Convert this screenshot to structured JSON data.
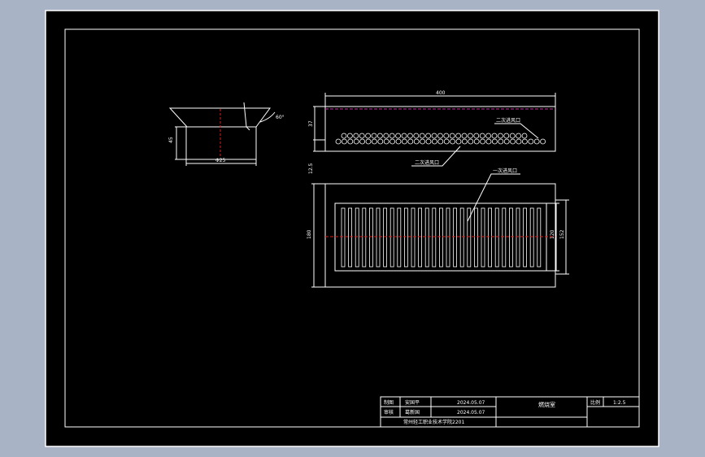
{
  "colors": {
    "background": "#a9b3c6",
    "paper": "#000000",
    "line": "#ffffff",
    "centerline": "#d61b1b",
    "dashline": "#c0309a"
  },
  "drawing": {
    "funnel": {
      "dim_height": "45",
      "dim_bottom": "Φ25",
      "dim_angle": "60°"
    },
    "side_view": {
      "dim_length": "400",
      "dim_height": "37",
      "dim_gap": "12.5",
      "label_upper_holes": "二次进风口",
      "label_lower_holes": "二次进风口"
    },
    "plan_view": {
      "label_slots": "一次进风口",
      "dim_outer_height": "180",
      "dim_inner_height": "120",
      "dim_right": "152"
    }
  },
  "title_block": {
    "row1_role": "制图",
    "row1_name": "安国平",
    "row1_date": "2024.05.07",
    "row2_role": "审核",
    "row2_name": "葛新国",
    "row2_date": "2024.05.07",
    "drawing_name": "燃烧室",
    "scale_label": "比例",
    "scale_value": "1:2.5",
    "school": "常州轻工职业技术学院2201"
  }
}
